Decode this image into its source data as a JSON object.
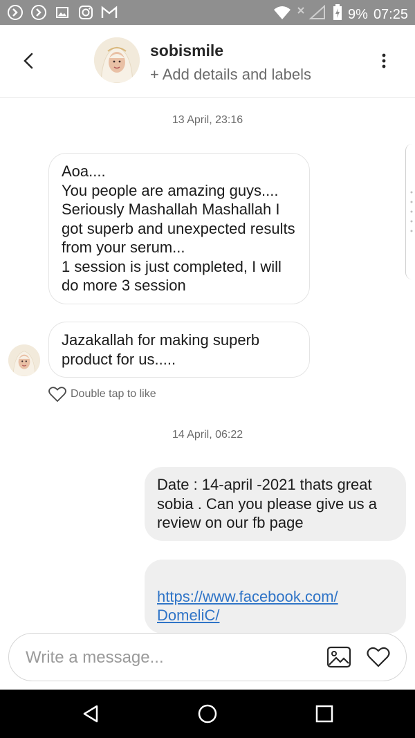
{
  "status_bar": {
    "battery": "9%",
    "time": "07:25",
    "icons": [
      "arrow-circle-icon",
      "arrow-circle-icon",
      "image-notification-icon",
      "instagram-icon",
      "gmail-icon",
      "wifi-icon",
      "no-signal-icon",
      "battery-charging-icon"
    ]
  },
  "header": {
    "username": "sobismile",
    "subtitle": "+ Add details and labels"
  },
  "chat": {
    "timestamp1": "13 April, 23:16",
    "msg1": "Aoa....\nYou people are amazing guys....\nSeriously Mashallah Mashallah I got superb and unexpected results from your serum...\n1 session is just  completed, I will do more 3 session",
    "msg2": "Jazakallah for making superb product for us.....",
    "like_hint": "Double tap to like",
    "timestamp2": "14 April, 06:22",
    "msg3": "Date : 14-april -2021  thats great sobia  . Can you please give us a review on our fb page",
    "msg4_link": "https://www.facebook.com/\nDomeliC/"
  },
  "composer": {
    "placeholder": "Write a message..."
  },
  "colors": {
    "status_bar": "#8f8f8f",
    "outgoing_bubble": "#efefef",
    "link": "#2f74c7",
    "nav_bar": "#000000"
  }
}
